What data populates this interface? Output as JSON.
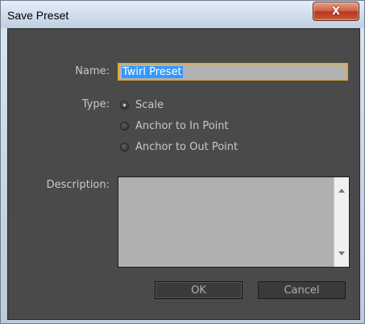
{
  "window": {
    "title": "Save Preset",
    "close_glyph": "X"
  },
  "form": {
    "name_label": "Name:",
    "name_value": "Twirl Preset",
    "type_label": "Type:",
    "type_options": [
      {
        "label": "Scale",
        "checked": true
      },
      {
        "label": "Anchor to In Point",
        "checked": false
      },
      {
        "label": "Anchor to Out Point",
        "checked": false
      }
    ],
    "description_label": "Description:",
    "description_value": ""
  },
  "buttons": {
    "ok_label": "OK",
    "cancel_label": "Cancel"
  }
}
